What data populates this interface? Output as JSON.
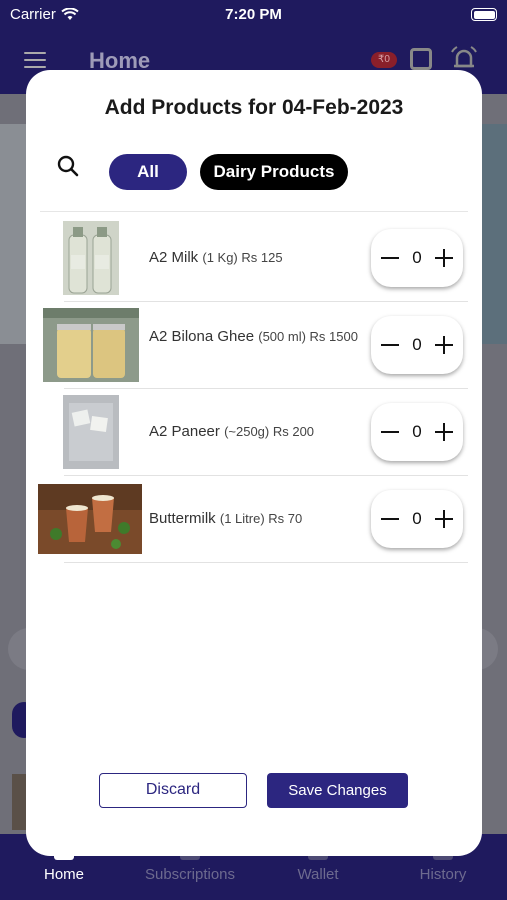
{
  "status_bar": {
    "carrier": "Carrier",
    "time": "7:20 PM"
  },
  "header": {
    "title": "Home",
    "wallet_balance": "₹0"
  },
  "tabs": [
    {
      "label": "Home",
      "active": true
    },
    {
      "label": "Subscriptions",
      "active": false
    },
    {
      "label": "Wallet",
      "active": false
    },
    {
      "label": "History",
      "active": false
    }
  ],
  "modal": {
    "title": "Add Products for 04-Feb-2023",
    "filters": [
      {
        "label": "All",
        "selected": true
      },
      {
        "label": "Dairy Products",
        "selected": false
      }
    ],
    "products": [
      {
        "name": "A2 Milk",
        "detail": "(1 Kg) Rs 125",
        "quantity": "0",
        "image": "milk-bottles"
      },
      {
        "name": "A2 Bilona Ghee",
        "detail": "(500 ml) Rs 1500",
        "quantity": "0",
        "image": "ghee-jars"
      },
      {
        "name": "A2 Paneer",
        "detail": "(~250g) Rs 200",
        "quantity": "0",
        "image": "paneer-block"
      },
      {
        "name": "Buttermilk",
        "detail": "(1 Litre) Rs 70",
        "quantity": "0",
        "image": "buttermilk-cups"
      }
    ],
    "discard_label": "Discard",
    "save_label": "Save Changes"
  },
  "colors": {
    "primary": "#2c2680",
    "header_bg": "#1f1a5e",
    "pill_dark": "#000000"
  }
}
